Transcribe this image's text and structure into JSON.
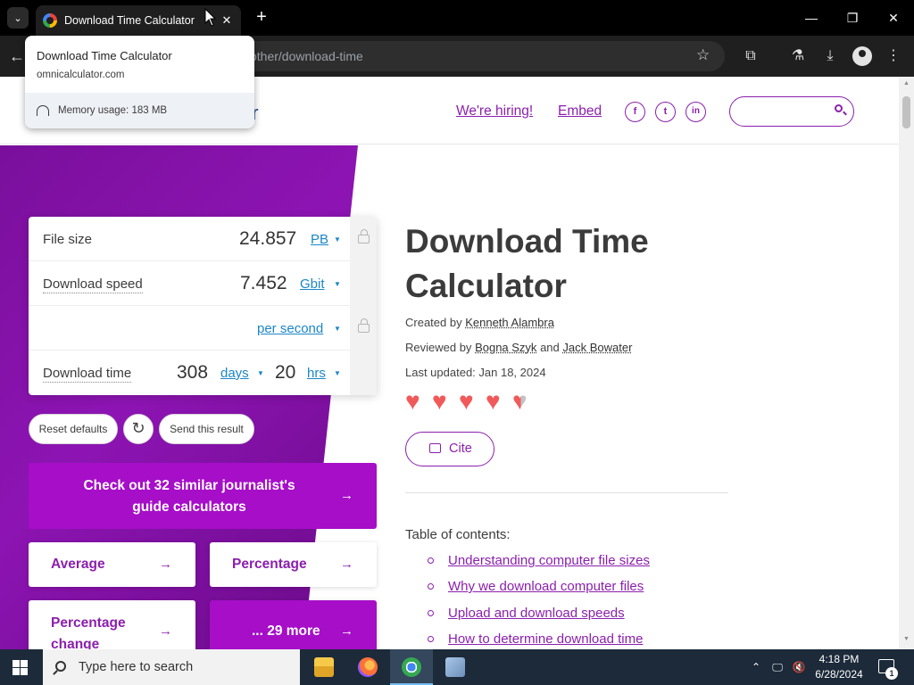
{
  "browser": {
    "tab_title": "Download Time Calculator",
    "tab_close": "✕",
    "new_tab": "+",
    "url_visible": "other/download-time",
    "window_controls": {
      "minimize": "—",
      "restore": "❐",
      "close": "✕"
    }
  },
  "hovercard": {
    "title": "Download Time Calculator",
    "domain": "omnicalculator.com",
    "memory": "Memory usage: 183 MB"
  },
  "header": {
    "logo_tail": "or",
    "hiring": "We're hiring!",
    "embed": "Embed",
    "social": {
      "facebook": "f",
      "twitter": "t",
      "linkedin": "in"
    }
  },
  "calculator": {
    "file_size": {
      "label": "File size",
      "value": "24.857",
      "unit": "PB"
    },
    "download_speed": {
      "label": "Download speed",
      "value": "7.452",
      "unit": "Gbit",
      "per": "per second"
    },
    "download_time": {
      "label": "Download time",
      "days_value": "308",
      "days_unit": "days",
      "hrs_value": "20",
      "hrs_unit": "hrs"
    },
    "reset": "Reset defaults",
    "send": "Send this result",
    "reload_icon": "↻"
  },
  "links": {
    "cta": "Check out 32 similar journalist's guide calculators",
    "average": "Average",
    "percentage": "Percentage",
    "percentage_change": "Percentage change",
    "more": "... 29 more",
    "arrow": "→"
  },
  "article": {
    "title_line1": "Download Time",
    "title_line2": "Calculator",
    "created_label": "Created by",
    "created_by": "Kenneth Alambra",
    "reviewed_label": "Reviewed by",
    "reviewer1": "Bogna Szyk",
    "and": "and",
    "reviewer2": "Jack Bowater",
    "updated": "Last updated: Jan 18, 2024",
    "rating": 4.5,
    "cite": "Cite",
    "toc_title": "Table of contents:",
    "toc": [
      "Understanding computer file sizes",
      "Why we download computer files",
      "Upload and download speeds",
      "How to determine download time"
    ]
  },
  "taskbar": {
    "search_placeholder": "Type here to search",
    "time": "4:18 PM",
    "date": "6/28/2024",
    "notification_count": "1"
  },
  "colors": {
    "brand_purple": "#8b1fad",
    "cta_purple": "#a60ec8",
    "unit_blue": "#1a86c7",
    "heart_red": "#f15a5a"
  }
}
